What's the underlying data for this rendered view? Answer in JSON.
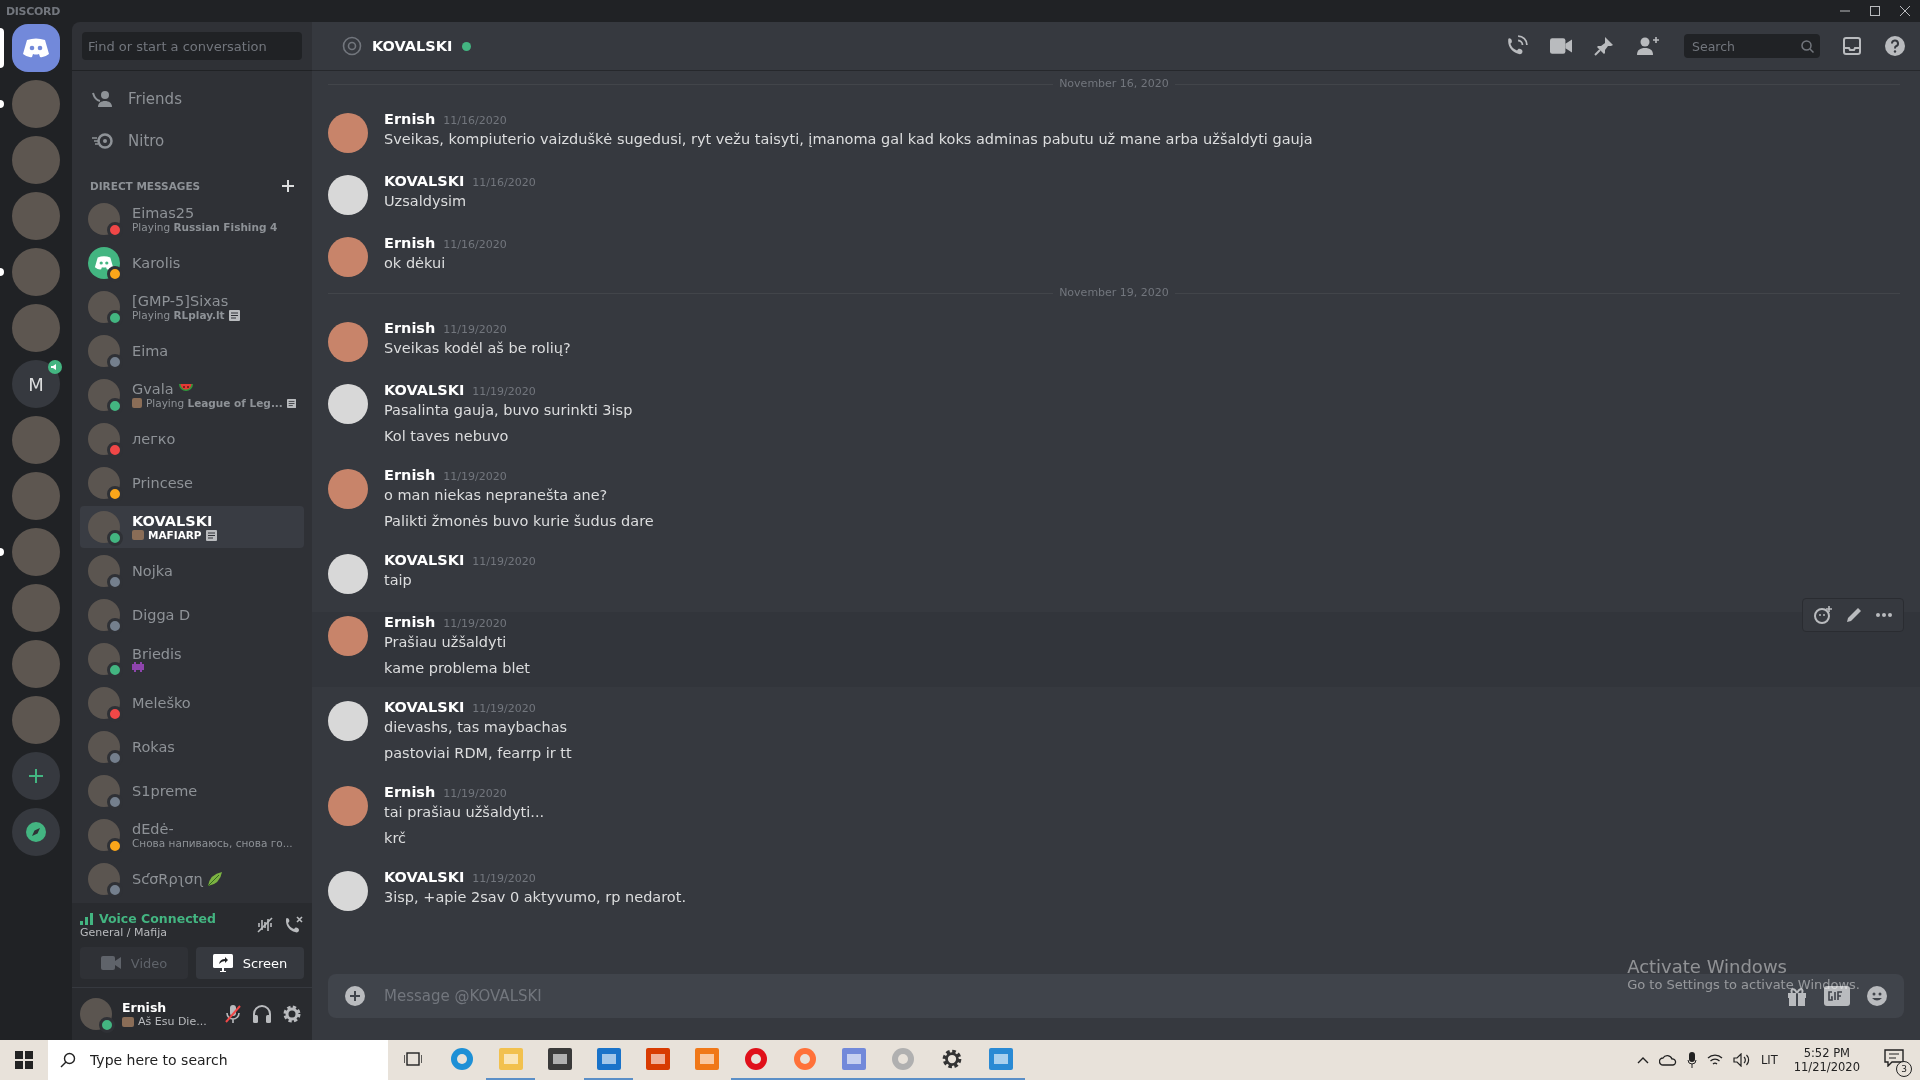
{
  "app_title": "DISCORD",
  "servers": [
    {
      "kind": "home",
      "selected": true
    },
    {
      "kind": "photo",
      "selected": false,
      "unread": true
    },
    {
      "kind": "photo",
      "selected": false,
      "unread": false
    },
    {
      "kind": "photo",
      "selected": false,
      "unread": false
    },
    {
      "kind": "photo",
      "selected": false,
      "unread": true
    },
    {
      "kind": "photo",
      "selected": false,
      "unread": false
    },
    {
      "kind": "letter",
      "label": "M",
      "selected": false,
      "unread": false,
      "speaker": true
    },
    {
      "kind": "photo",
      "selected": false,
      "unread": false
    },
    {
      "kind": "photo",
      "selected": false,
      "unread": false
    },
    {
      "kind": "photo",
      "selected": false,
      "unread": true
    },
    {
      "kind": "photo",
      "selected": false,
      "unread": false
    },
    {
      "kind": "photo",
      "selected": false,
      "unread": false
    },
    {
      "kind": "photo",
      "selected": false,
      "unread": false
    },
    {
      "kind": "add"
    },
    {
      "kind": "explore"
    }
  ],
  "dm_search": {
    "placeholder": "Find or start a conversation"
  },
  "nav": [
    {
      "kind": "friends",
      "label": "Friends"
    },
    {
      "kind": "nitro",
      "label": "Nitro"
    }
  ],
  "dm_heading": "DIRECT MESSAGES",
  "dms": [
    {
      "name": "Eimas25",
      "activity": "Playing **Russian Fishing 4**",
      "color": "#f04747",
      "kind": "photo",
      "selected": false
    },
    {
      "name": "Karolis",
      "color": "#faa61a",
      "kind": "default",
      "selected": false
    },
    {
      "name": "[GMP-5]Sixas",
      "activity": "Playing **RLplay.lt**",
      "rich_presence": true,
      "color": "#43b581",
      "kind": "photo",
      "selected": false
    },
    {
      "name": "Eima",
      "color": "#747f8d",
      "kind": "photo",
      "selected": false
    },
    {
      "name": "Gvala",
      "name_emoji": {
        "kind": "watermelon"
      },
      "activity_icon": true,
      "activity": "Playing **League of Leg...**",
      "rich_presence": true,
      "color": "#43b581",
      "kind": "photo",
      "selected": false
    },
    {
      "name": "легко",
      "color": "#f04747",
      "kind": "photo",
      "selected": false
    },
    {
      "name": "Princese",
      "color": "#faa61a",
      "kind": "photo",
      "selected": false
    },
    {
      "name": "KOVALSKI",
      "activity_icon": true,
      "activity": "**MAFIARP**",
      "rich_presence": true,
      "color": "#43b581",
      "kind": "photo",
      "selected": true
    },
    {
      "name": "Nojka",
      "color": "#747f8d",
      "kind": "photo",
      "selected": false
    },
    {
      "name": "Digga D",
      "color": "#747f8d",
      "kind": "photo",
      "selected": false
    },
    {
      "name": "Briedis",
      "status_emoji": {
        "kind": "alien"
      },
      "color": "#43b581",
      "kind": "photo",
      "selected": false
    },
    {
      "name": "Meleško",
      "color": "#f04747",
      "kind": "photo",
      "selected": false
    },
    {
      "name": "Rokas",
      "color": "#747f8d",
      "kind": "photo",
      "selected": false
    },
    {
      "name": "S1preme",
      "color": "#747f8d",
      "kind": "photo",
      "selected": false
    },
    {
      "name": "dEdė-",
      "activity": "Снова напиваюсь, снова го...",
      "color": "#faa61a",
      "kind": "photo",
      "selected": false
    },
    {
      "name": "SƈσRρʅσɳ",
      "name_emoji": {
        "kind": "leaf"
      },
      "color": "#747f8d",
      "kind": "photo",
      "selected": false
    }
  ],
  "voice": {
    "status": "Voice Connected",
    "channel": "General / Mafija",
    "buttons": [
      {
        "kind": "video",
        "label": "Video",
        "disabled": true
      },
      {
        "kind": "screen",
        "label": "Screen",
        "disabled": false
      }
    ]
  },
  "user": {
    "name": "Ernish",
    "custom_status": "Aš Esu Die...",
    "color": "#43b581",
    "mic_muted": true
  },
  "chat": {
    "recipient": "KOVALSKI",
    "color": "#43b581",
    "search": {
      "placeholder": "Search"
    },
    "composer": {
      "placeholder": "Message @KOVALSKI"
    },
    "items": [
      {
        "kind": "divider",
        "label": "November 16, 2020"
      },
      {
        "kind": "message",
        "author": "Ernish",
        "time": "11/16/2020",
        "hovered": false,
        "lines": [
          "Sveikas, kompiuterio vaizduškė sugedusi, ryt vežu taisyti, įmanoma gal kad koks adminas pabutu už mane arba užšaldyti gauja"
        ]
      },
      {
        "kind": "message",
        "author": "KOVALSKI",
        "time": "11/16/2020",
        "hovered": false,
        "lines": [
          "Uzsaldysim"
        ]
      },
      {
        "kind": "message",
        "author": "Ernish",
        "time": "11/16/2020",
        "hovered": false,
        "lines": [
          "ok dėkui"
        ]
      },
      {
        "kind": "divider",
        "label": "November 19, 2020"
      },
      {
        "kind": "message",
        "author": "Ernish",
        "time": "11/19/2020",
        "hovered": false,
        "lines": [
          "Sveikas kodėl aš be rolių?"
        ]
      },
      {
        "kind": "message",
        "author": "KOVALSKI",
        "time": "11/19/2020",
        "hovered": false,
        "lines": [
          "Pasalinta gauja, buvo surinkti 3isp",
          "Kol taves nebuvo"
        ]
      },
      {
        "kind": "message",
        "author": "Ernish",
        "time": "11/19/2020",
        "hovered": false,
        "lines": [
          "o man niekas nepranešta ane?",
          "Palikti žmonės buvo kurie šudus dare"
        ]
      },
      {
        "kind": "message",
        "author": "KOVALSKI",
        "time": "11/19/2020",
        "hovered": false,
        "lines": [
          "taip"
        ]
      },
      {
        "kind": "message",
        "author": "Ernish",
        "time": "11/19/2020",
        "hovered": true,
        "lines": [
          "Prašiau užšaldyti",
          "kame problema blet"
        ]
      },
      {
        "kind": "message",
        "author": "KOVALSKI",
        "time": "11/19/2020",
        "hovered": false,
        "lines": [
          "dievashs, tas maybachas",
          "pastoviai RDM, fearrp ir tt"
        ]
      },
      {
        "kind": "message",
        "author": "Ernish",
        "time": "11/19/2020",
        "hovered": false,
        "lines": [
          "tai prašiau užšaldyti...",
          "krč"
        ]
      },
      {
        "kind": "message",
        "author": "KOVALSKI",
        "time": "11/19/2020",
        "hovered": false,
        "lines": [
          "3isp, +apie 2sav 0 aktyvumo, rp nedarot."
        ]
      }
    ]
  },
  "activation": {
    "title": "Activate Windows",
    "subtitle": "Go to Settings to activate Windows."
  },
  "taskbar": {
    "search": {
      "placeholder": "Type here to search"
    },
    "apps": [
      {
        "kind": "taskview",
        "running": false
      },
      {
        "kind": "edge",
        "running": false
      },
      {
        "kind": "explorer",
        "running": true
      },
      {
        "kind": "store",
        "running": false
      },
      {
        "kind": "mail",
        "running": true
      },
      {
        "kind": "office",
        "running": false
      },
      {
        "kind": "app",
        "running": false
      },
      {
        "kind": "opera",
        "running": true
      },
      {
        "kind": "firefox",
        "running": true
      },
      {
        "kind": "discord",
        "running": true
      },
      {
        "kind": "disc",
        "running": true
      },
      {
        "kind": "settings",
        "running": true
      },
      {
        "kind": "remote",
        "running": true
      }
    ],
    "language": "LIT",
    "time": "5:52 PM",
    "date": "11/21/2020",
    "notifications": "3"
  }
}
